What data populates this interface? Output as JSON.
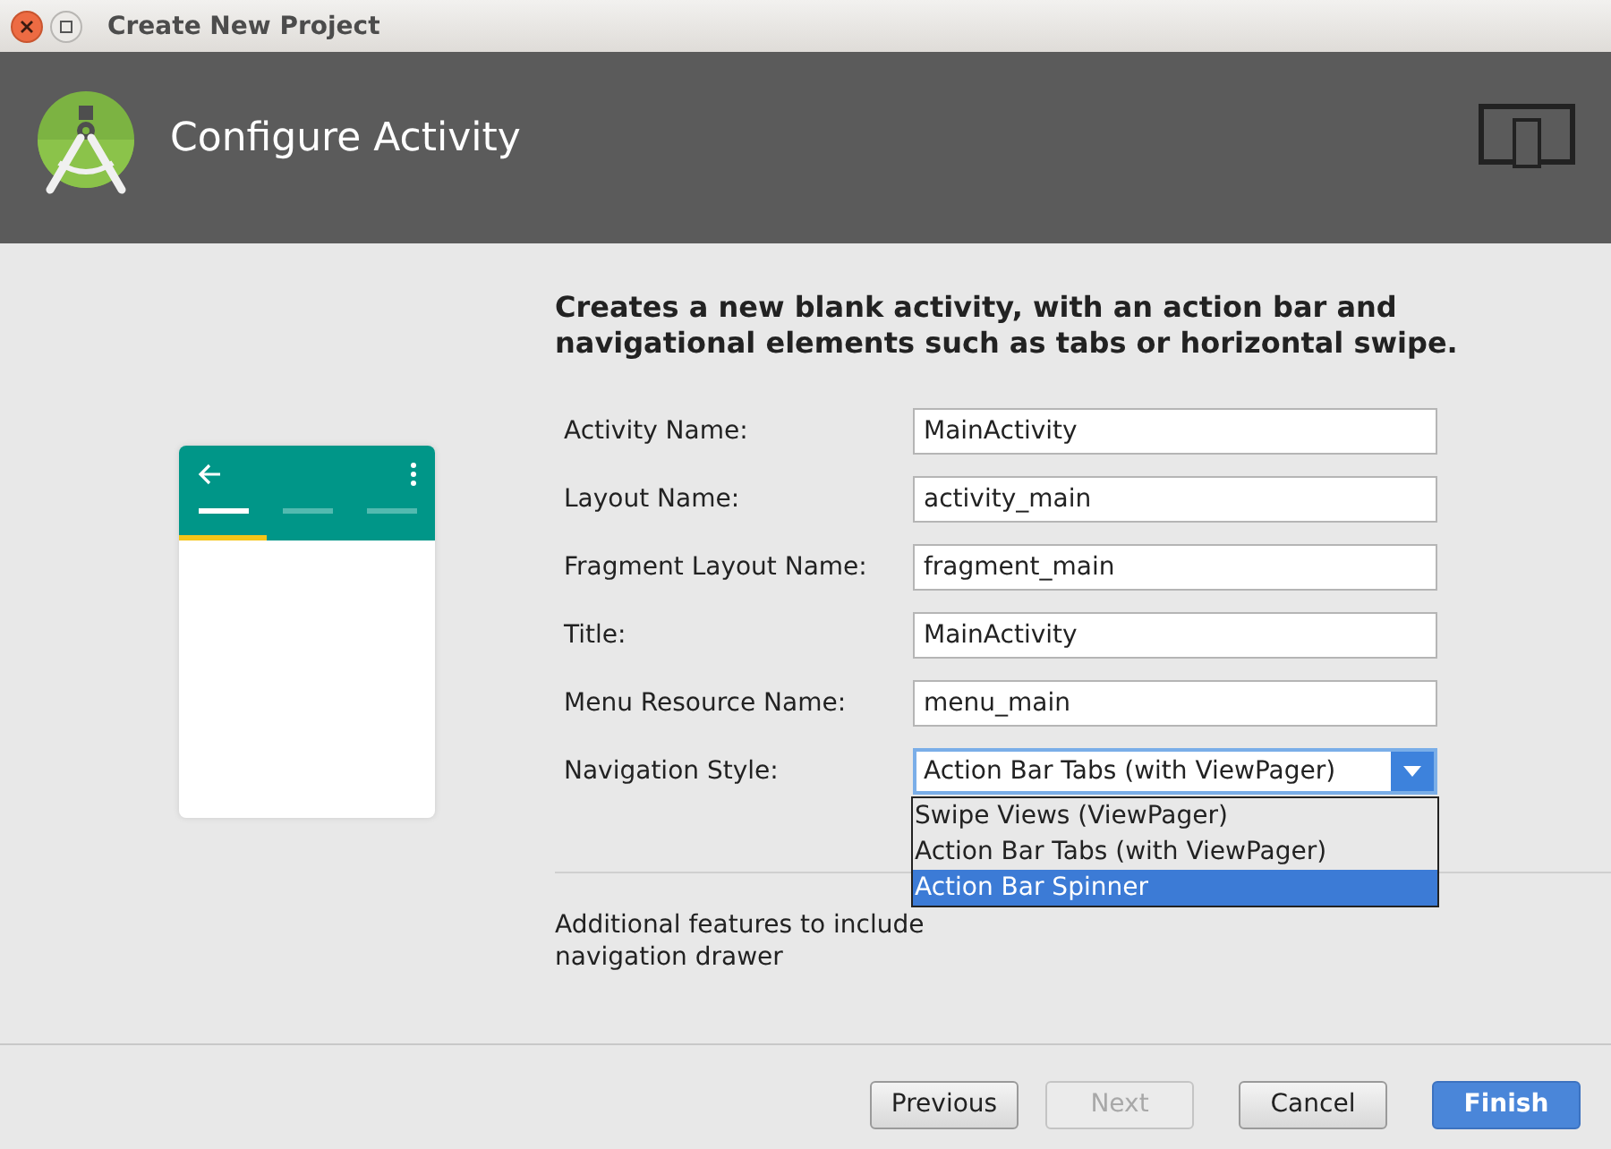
{
  "window": {
    "title": "Create New Project"
  },
  "header": {
    "title": "Configure Activity"
  },
  "description": "Creates a new blank activity, with an action bar and navigational elements such as tabs or horizontal swipe.",
  "fields": [
    {
      "label": "Activity Name:",
      "value": "MainActivity"
    },
    {
      "label": "Layout Name:",
      "value": "activity_main"
    },
    {
      "label": "Fragment Layout Name:",
      "value": "fragment_main"
    },
    {
      "label": "Title:",
      "value": "MainActivity"
    },
    {
      "label": "Menu Resource Name:",
      "value": "menu_main"
    }
  ],
  "navigation_style": {
    "label": "Navigation Style:",
    "value": "Action Bar Tabs (with ViewPager)",
    "expanded": true,
    "options": [
      {
        "label": "Swipe Views (ViewPager)",
        "highlighted": false
      },
      {
        "label": "Action Bar Tabs (with ViewPager)",
        "highlighted": false
      },
      {
        "label": "Action Bar Spinner",
        "highlighted": true
      }
    ]
  },
  "hint_lines": [
    "Additional features to include",
    "navigation drawer"
  ],
  "buttons": [
    {
      "label": "Previous",
      "kind": "normal",
      "disabled": false
    },
    {
      "label": "Next",
      "kind": "normal",
      "disabled": true
    },
    {
      "label": "Cancel",
      "kind": "normal",
      "disabled": false
    },
    {
      "label": "Finish",
      "kind": "primary",
      "disabled": false
    }
  ]
}
